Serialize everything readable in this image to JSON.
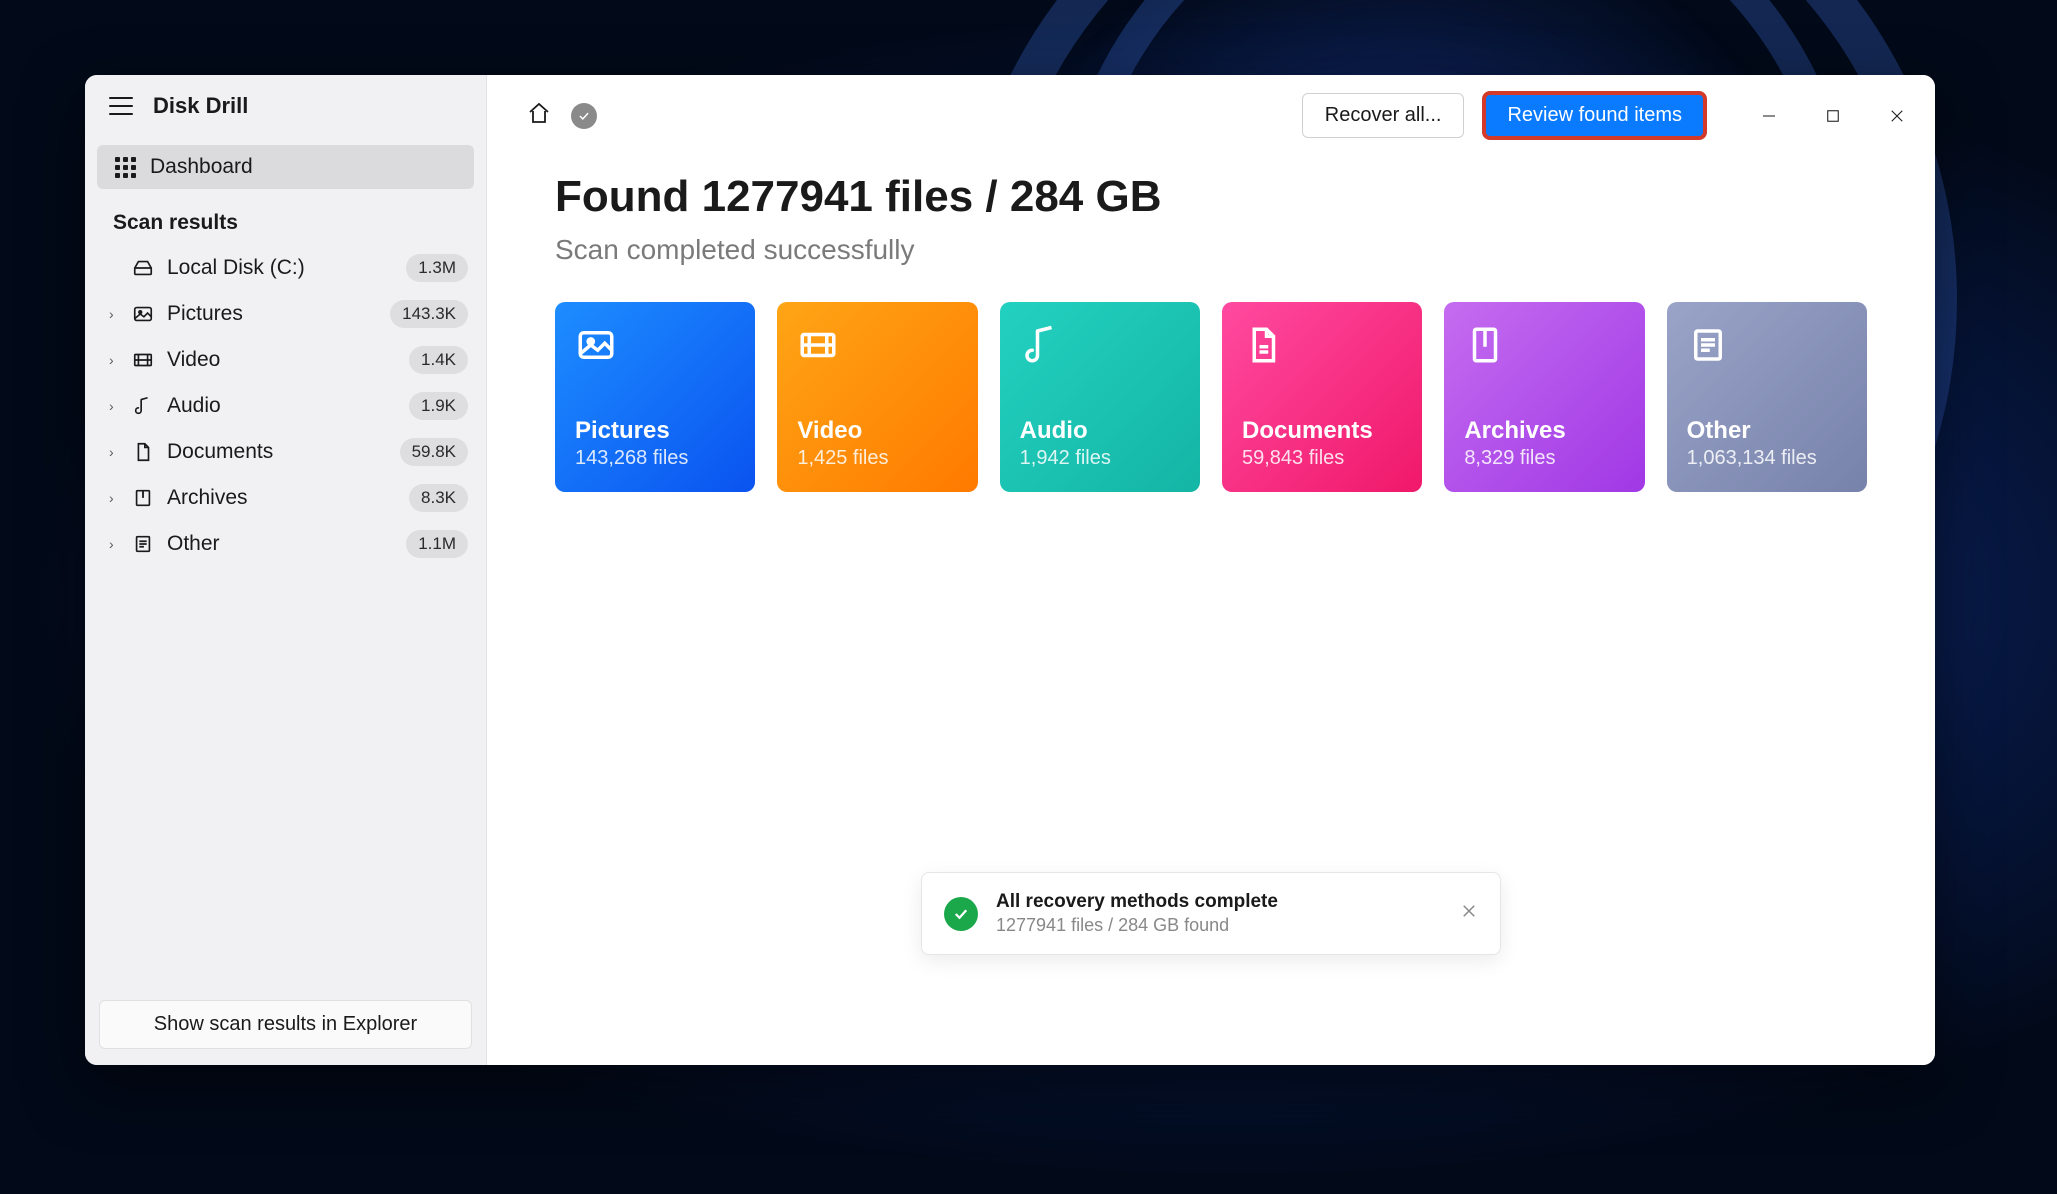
{
  "app": {
    "name": "Disk Drill"
  },
  "sidebar": {
    "dashboard_label": "Dashboard",
    "section_title": "Scan results",
    "disk": {
      "label": "Local Disk (C:)",
      "badge": "1.3M"
    },
    "items": [
      {
        "label": "Pictures",
        "badge": "143.3K"
      },
      {
        "label": "Video",
        "badge": "1.4K"
      },
      {
        "label": "Audio",
        "badge": "1.9K"
      },
      {
        "label": "Documents",
        "badge": "59.8K"
      },
      {
        "label": "Archives",
        "badge": "8.3K"
      },
      {
        "label": "Other",
        "badge": "1.1M"
      }
    ],
    "footer_button": "Show scan results in Explorer"
  },
  "toolbar": {
    "recover_label": "Recover all...",
    "review_label": "Review found items"
  },
  "results": {
    "title": "Found 1277941 files / 284 GB",
    "subtitle": "Scan completed successfully"
  },
  "cards": [
    {
      "label": "Pictures",
      "count": "143,268 files"
    },
    {
      "label": "Video",
      "count": "1,425 files"
    },
    {
      "label": "Audio",
      "count": "1,942 files"
    },
    {
      "label": "Documents",
      "count": "59,843 files"
    },
    {
      "label": "Archives",
      "count": "8,329 files"
    },
    {
      "label": "Other",
      "count": "1,063,134 files"
    }
  ],
  "toast": {
    "title": "All recovery methods complete",
    "subtitle": "1277941 files / 284 GB found"
  }
}
